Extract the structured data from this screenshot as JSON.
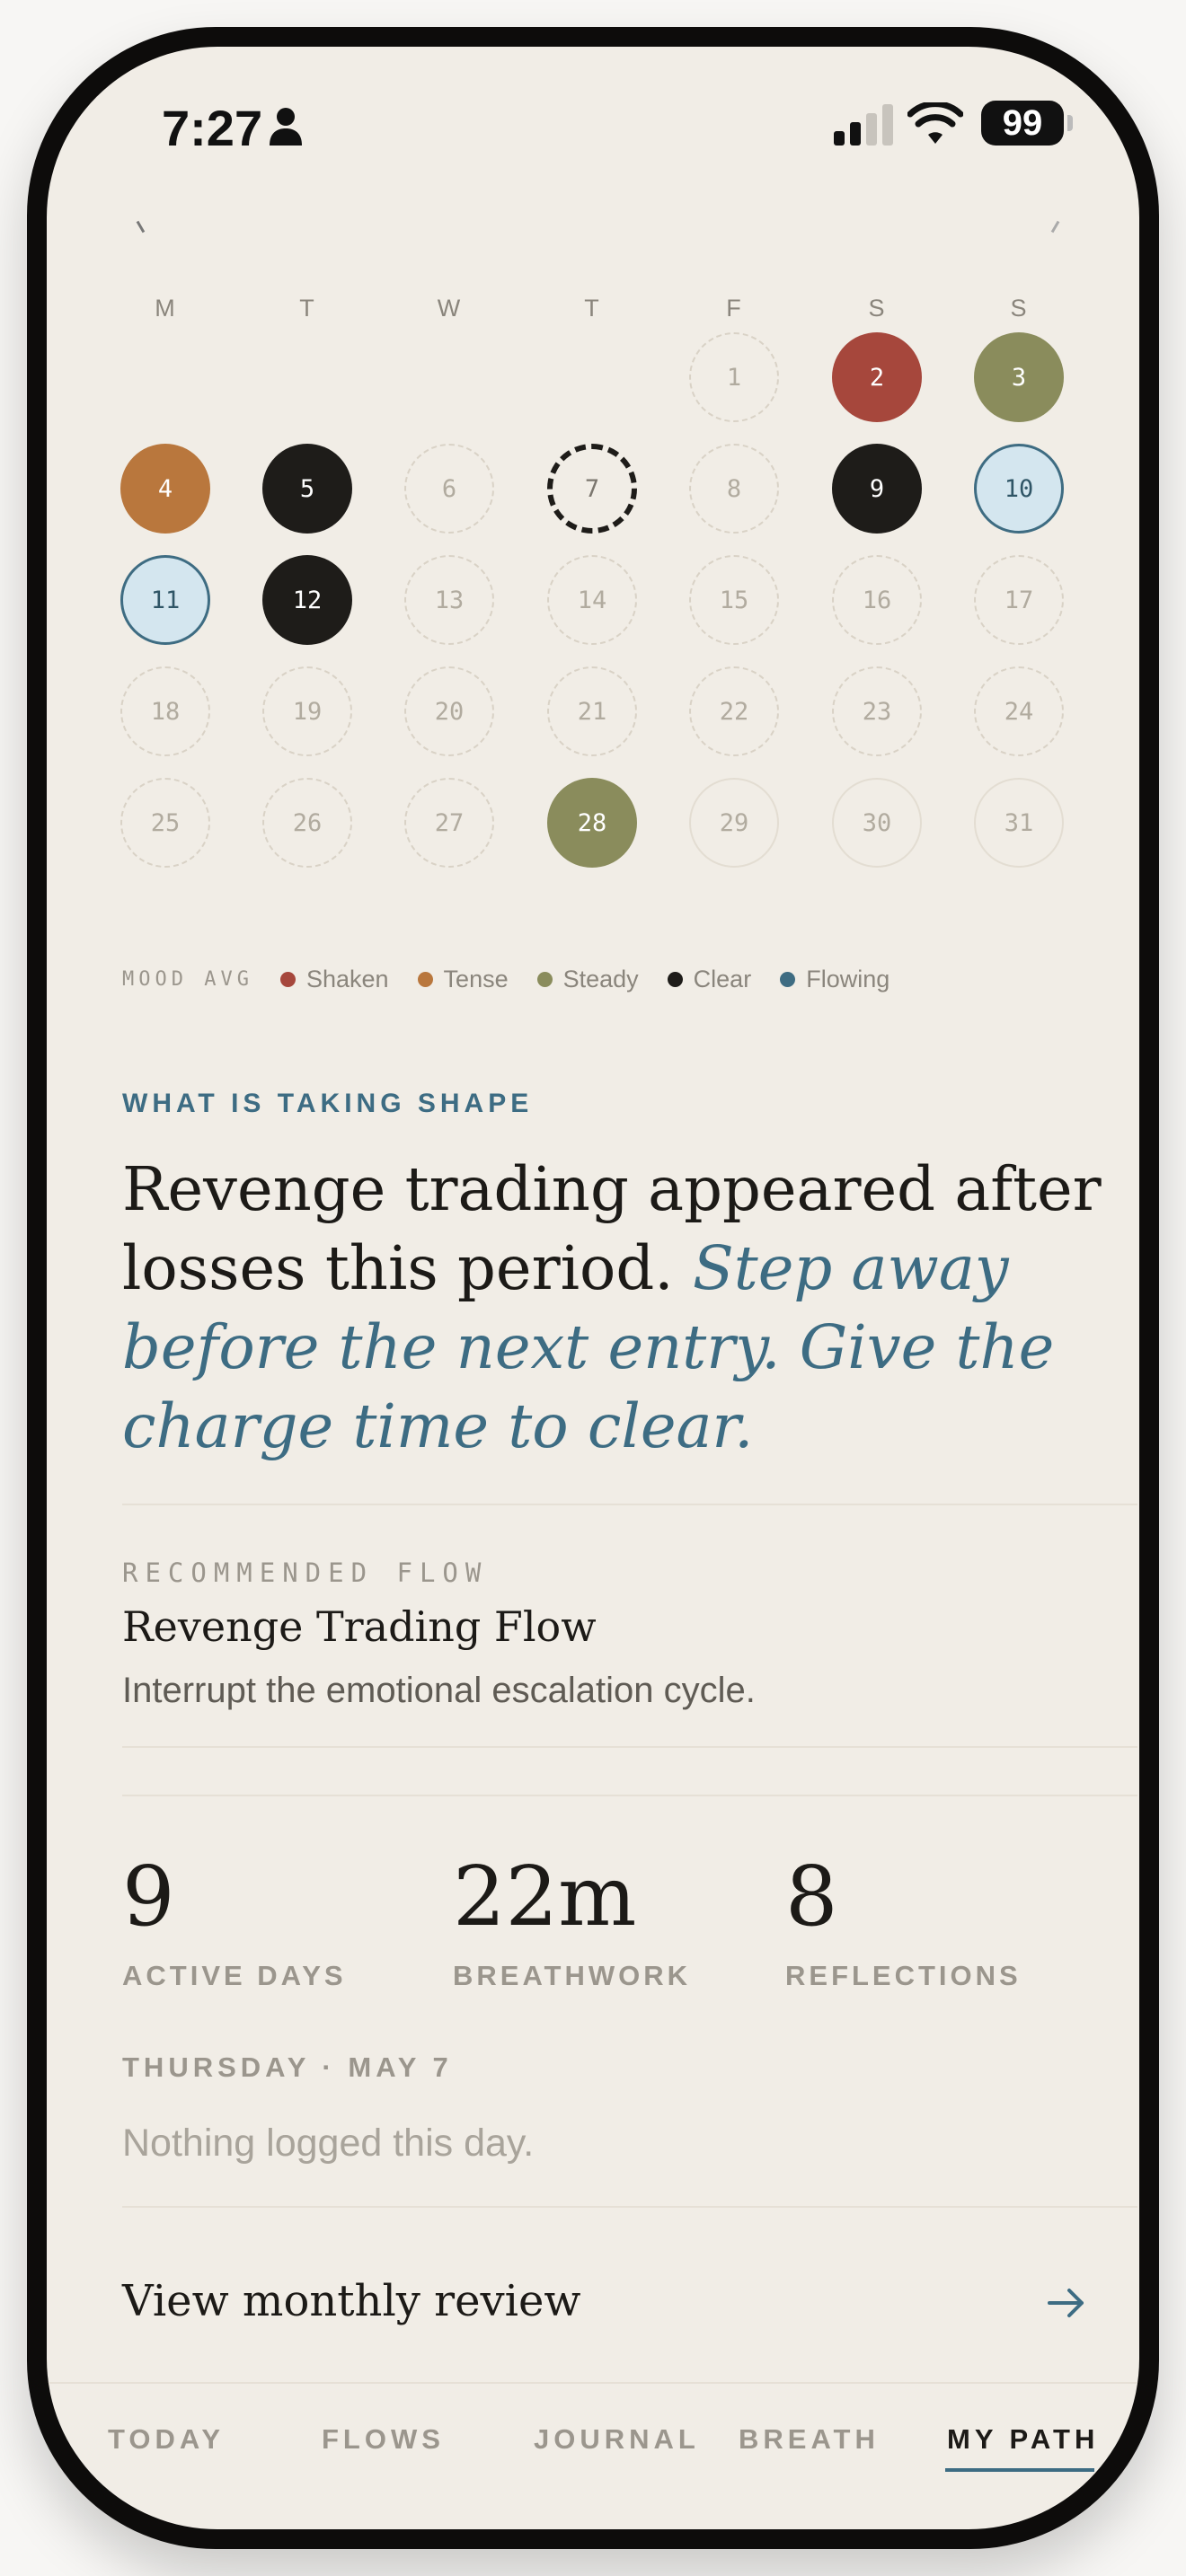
{
  "status_bar": {
    "time": "7:27",
    "battery": "99"
  },
  "calendar": {
    "weekdays": [
      "M",
      "T",
      "W",
      "T",
      "F",
      "S",
      "S"
    ],
    "days": [
      {
        "label": "1",
        "mood": "empty"
      },
      {
        "label": "2",
        "mood": "shaken"
      },
      {
        "label": "3",
        "mood": "steady"
      },
      {
        "label": "4",
        "mood": "tense"
      },
      {
        "label": "5",
        "mood": "clear"
      },
      {
        "label": "6",
        "mood": "empty"
      },
      {
        "label": "7",
        "mood": "today"
      },
      {
        "label": "8",
        "mood": "empty"
      },
      {
        "label": "9",
        "mood": "clear"
      },
      {
        "label": "10",
        "mood": "flowing"
      },
      {
        "label": "11",
        "mood": "flowing"
      },
      {
        "label": "12",
        "mood": "clear"
      },
      {
        "label": "13",
        "mood": "empty"
      },
      {
        "label": "14",
        "mood": "empty"
      },
      {
        "label": "15",
        "mood": "empty"
      },
      {
        "label": "16",
        "mood": "empty"
      },
      {
        "label": "17",
        "mood": "empty"
      },
      {
        "label": "18",
        "mood": "empty"
      },
      {
        "label": "19",
        "mood": "empty"
      },
      {
        "label": "20",
        "mood": "empty"
      },
      {
        "label": "21",
        "mood": "empty"
      },
      {
        "label": "22",
        "mood": "empty"
      },
      {
        "label": "23",
        "mood": "empty"
      },
      {
        "label": "24",
        "mood": "empty"
      },
      {
        "label": "25",
        "mood": "empty"
      },
      {
        "label": "26",
        "mood": "empty"
      },
      {
        "label": "27",
        "mood": "empty"
      },
      {
        "label": "28",
        "mood": "steady"
      },
      {
        "label": "29",
        "mood": "future"
      },
      {
        "label": "30",
        "mood": "future"
      },
      {
        "label": "31",
        "mood": "future"
      }
    ]
  },
  "legend": {
    "title": "MOOD AVG",
    "items": [
      {
        "label": "Shaken",
        "color": "#a6473c"
      },
      {
        "label": "Tense",
        "color": "#b9773d"
      },
      {
        "label": "Steady",
        "color": "#8a8c5c"
      },
      {
        "label": "Clear",
        "color": "#1e1c19"
      },
      {
        "label": "Flowing",
        "color": "#3e6c82"
      }
    ]
  },
  "insight": {
    "eyebrow": "WHAT IS TAKING SHAPE",
    "headline": "Revenge trading appeared after losses this period.",
    "advice": "Step away before the next entry. Give the charge time to clear."
  },
  "recommended": {
    "label": "RECOMMENDED FLOW",
    "title": "Revenge Trading Flow",
    "description": "Interrupt the emotional escalation cycle."
  },
  "stats": [
    {
      "value": "9",
      "label": "ACTIVE DAYS"
    },
    {
      "value": "22m",
      "label": "BREATHWORK"
    },
    {
      "value": "8",
      "label": "REFLECTIONS"
    }
  ],
  "selected_day": {
    "heading": "THURSDAY · MAY 7",
    "empty_text": "Nothing logged this day."
  },
  "review_link": {
    "label": "View monthly review"
  },
  "tabs": [
    {
      "label": "TODAY",
      "active": false
    },
    {
      "label": "FLOWS",
      "active": false
    },
    {
      "label": "JOURNAL",
      "active": false
    },
    {
      "label": "BREATH",
      "active": false
    },
    {
      "label": "MY PATH",
      "active": true
    }
  ]
}
